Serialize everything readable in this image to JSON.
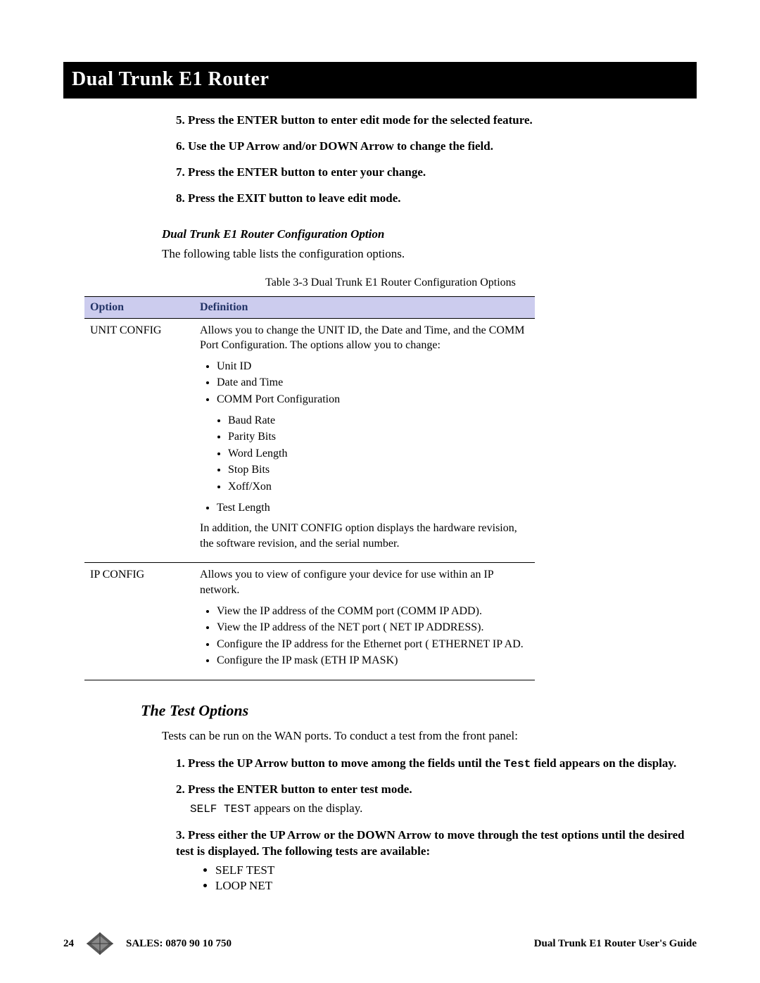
{
  "header": {
    "title": "Dual Trunk E1 Router"
  },
  "steps": {
    "s5": "5.  Press the ENTER button to enter edit mode for the selected feature.",
    "s6": "6.  Use the UP Arrow and/or DOWN Arrow to change the field.",
    "s7": "7.  Press the ENTER button to enter your change.",
    "s8": "8.  Press the EXIT button to leave edit mode."
  },
  "config": {
    "heading": "Dual Trunk E1 Router Configuration Option",
    "intro": "The following table lists the  configuration options.",
    "caption": "Table 3-3    Dual Trunk E1 Router Configuration Options",
    "col_option": "Option",
    "col_definition": "Definition",
    "row1": {
      "option": "UNIT CONFIG",
      "lead": "Allows you to change the UNIT ID, the Date and Time, and the COMM Port Configuration. The options allow you to change:",
      "b1": "Unit ID",
      "b2": "Date and Time",
      "b3": "COMM Port Configuration",
      "n1": "Baud Rate",
      "n2": "Parity Bits",
      "n3": "Word Length",
      "n4": "Stop Bits",
      "n5": "Xoff/Xon",
      "b4": "Test Length",
      "tail": "In addition, the UNIT CONFIG option displays the hardware revision, the software revision, and the serial number."
    },
    "row2": {
      "option": "IP CONFIG",
      "lead": "Allows you to view of configure your device for use within an IP network.",
      "b1": "View the IP address of the COMM port (COMM IP ADD).",
      "b2": "View the IP address of the NET port ( NET IP ADDRESS).",
      "b3": "Configure the IP address for the Ethernet port ( ETHERNET IP AD.",
      "b4": "Configure the IP mask (ETH IP MASK)"
    }
  },
  "tests": {
    "heading": "The Test Options",
    "intro": "Tests can be run on the WAN ports. To conduct a test from the front panel:",
    "s1_a": "1.  Press the UP Arrow button to move among the fields until the ",
    "s1_test": "Test",
    "s1_b": " field appears on the display.",
    "s2": "2.  Press the ENTER button to enter test mode.",
    "s2_sub_a": "SELF TEST",
    "s2_sub_b": " appears on the display.",
    "s3": "3.  Press either the UP Arrow or the DOWN Arrow to move through the test options until the desired test is displayed. The following tests are available:",
    "s3_b1": "SELF TEST",
    "s3_b2": "LOOP NET"
  },
  "footer": {
    "page": "24",
    "sales": "SALES: 0870 90 10 750",
    "guide": "Dual Trunk E1 Router User's Guide"
  }
}
